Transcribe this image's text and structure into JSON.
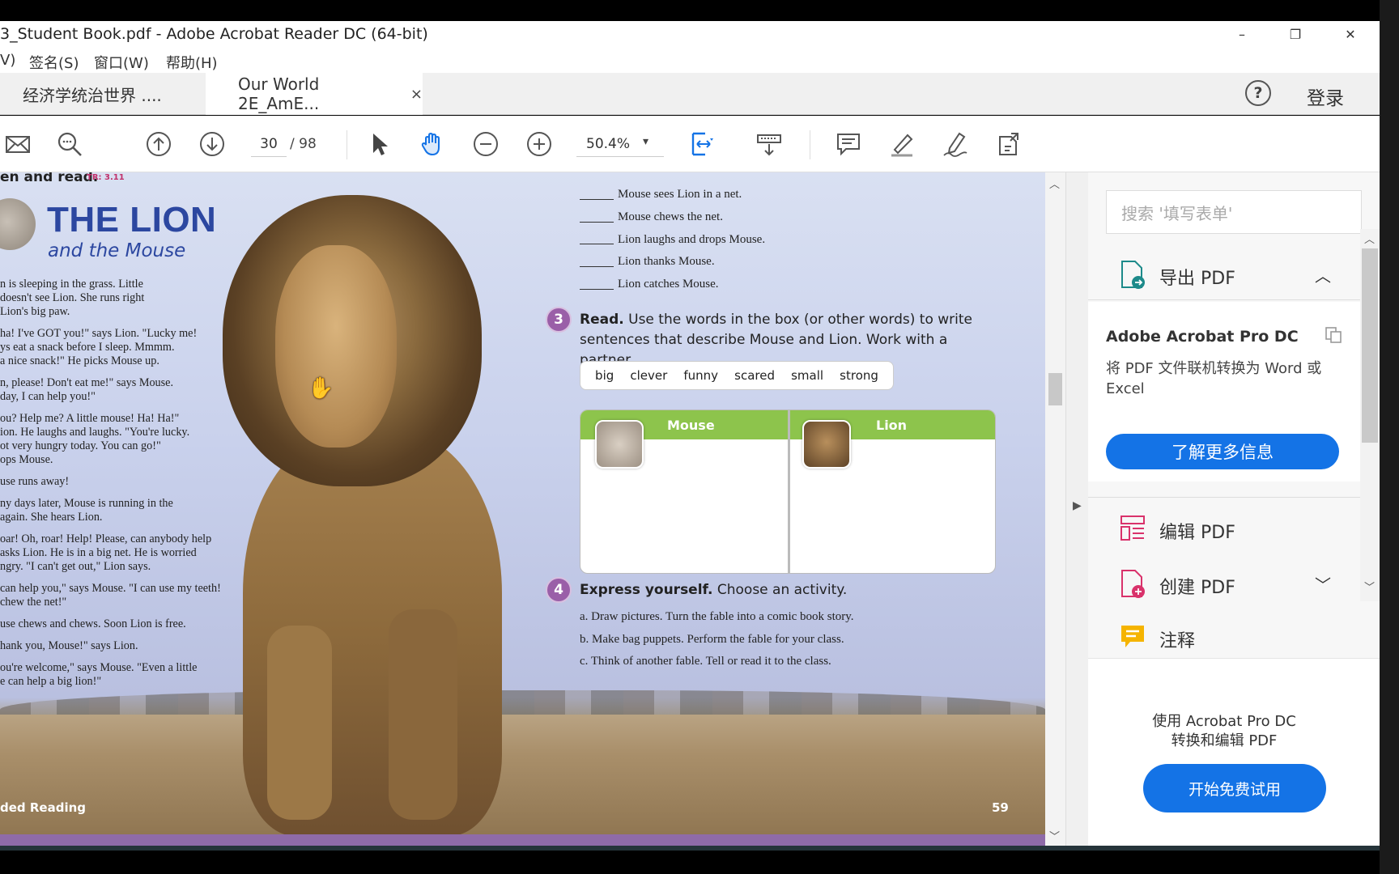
{
  "window": {
    "title": "3_Student Book.pdf - Adobe Acrobat Reader DC (64-bit)",
    "minimize": "–",
    "restore": "❐",
    "close": "✕"
  },
  "menu": {
    "items": [
      "V)",
      "签名(S)",
      "窗口(W)",
      "帮助(H)"
    ]
  },
  "tabs": [
    {
      "label": "经济学统治世界 ...."
    },
    {
      "label": "Our World 2E_AmE...",
      "close": "×"
    }
  ],
  "header": {
    "help": "?",
    "login": "登录"
  },
  "toolbar": {
    "page_current": "30",
    "page_total": "/ 98",
    "zoom": "50.4%",
    "zoom_caret": "▾"
  },
  "document": {
    "heading": "en and read.",
    "track": "TR: 3.11",
    "title": "THE LION",
    "subtitle": "and the Mouse",
    "story": [
      "n is sleeping in the grass. Little\n doesn't see Lion. She runs right\nLion's big paw.",
      "ha! I've GOT you!\" says Lion. \"Lucky me!\nys eat a snack before I sleep. Mmmm.\na nice snack!\" He picks Mouse up.",
      "n, please! Don't eat me!\" says Mouse.\nday, I can help you!\"",
      "ou? Help me? A little mouse! Ha! Ha!\"\nion. He laughs and laughs. \"You're lucky.\not very hungry today. You can go!\"\nops Mouse.",
      "use runs away!",
      "ny days later, Mouse is running in the\nagain. She hears Lion.",
      "oar! Oh, roar! Help! Please, can anybody help\nasks Lion. He is in a big net. He is worried\nngry. \"I can't get out,\" Lion says.",
      "can help you,\" says Mouse. \"I can use my teeth!\nchew the net!\"",
      "use chews and chews. Soon Lion is free.",
      "hank you, Mouse!\" says Lion.",
      "ou're welcome,\" says Mouse. \"Even a little\ne can help a big lion!\""
    ],
    "footer_left": "ded Reading",
    "footer_right": "59",
    "sequence": [
      "Mouse sees Lion in a net.",
      "Mouse chews the net.",
      "Lion laughs and drops Mouse.",
      "Lion thanks Mouse.",
      "Lion catches Mouse."
    ],
    "section3": {
      "num": "3",
      "bold": "Read.",
      "line1": "Use the words in the box (or other words) to write",
      "line2": "sentences that describe Mouse and Lion. Work with a partner."
    },
    "words": [
      "big",
      "clever",
      "funny",
      "scared",
      "small",
      "strong"
    ],
    "table": {
      "col1": "Mouse",
      "col2": "Lion"
    },
    "section4": {
      "num": "4",
      "bold": "Express yourself.",
      "rest": "Choose an activity."
    },
    "activities": [
      "a. Draw pictures. Turn the fable into a comic book story.",
      "b. Make bag puppets. Perform the fable for your class.",
      "c. Think of another fable. Tell or read it to the class."
    ]
  },
  "panel": {
    "search_placeholder": "搜索 '填写表单'",
    "export": "导出 PDF",
    "promo_title": "Adobe Acrobat Pro DC",
    "promo_desc": "将 PDF 文件联机转换为 Word 或 Excel",
    "promo_btn": "了解更多信息",
    "edit": "编辑 PDF",
    "create": "创建 PDF",
    "comment": "注释",
    "foot_line1": "使用 Acrobat Pro DC",
    "foot_line2": "转换和编辑 PDF",
    "trial_btn": "开始免费试用",
    "chev_up": "︿",
    "chev_down": "﹀"
  },
  "colors": {
    "accent": "#1473e6",
    "title_blue": "#2c47a0",
    "section_purple": "#9a5fa8",
    "table_green": "#8dc44c"
  }
}
